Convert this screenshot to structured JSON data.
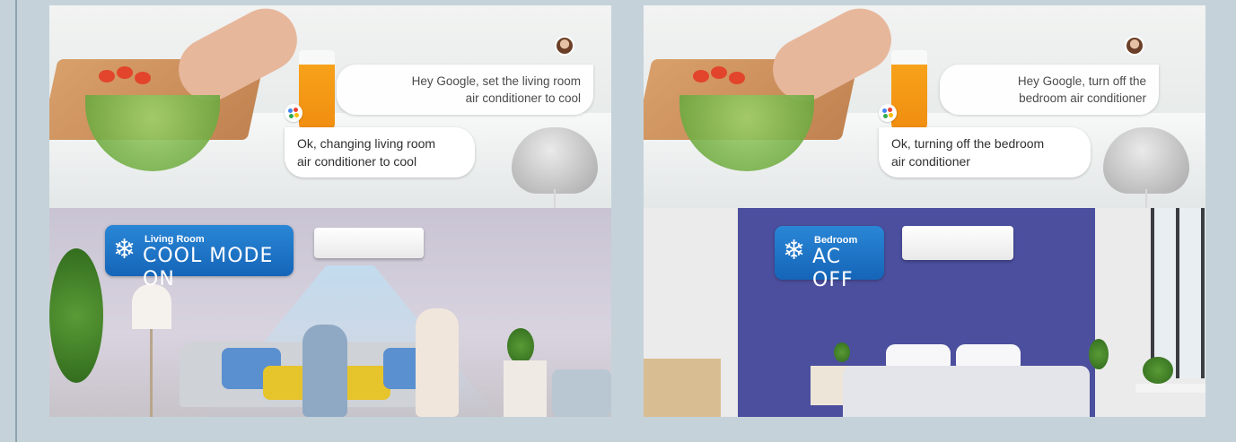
{
  "colors": {
    "page_background": "#c5d2da",
    "badge_blue": "#1e78c8",
    "bedroom_wall": "#4b4f9e"
  },
  "panels": [
    {
      "user_message": "Hey Google, set the living room air conditioner to cool",
      "user_line1": "Hey Google, set the living room",
      "user_line2": "air conditioner to cool",
      "assistant_line1": "Ok, changing living room",
      "assistant_line2": "air conditioner to cool",
      "status_room": "Living Room",
      "status_text": "COOL MODE ON",
      "status_icon": "snowflake-icon"
    },
    {
      "user_line1": "Hey Google, turn off the",
      "user_line2": "bedroom air conditioner",
      "assistant_line1": "Ok, turning off the bedroom",
      "assistant_line2": "air conditioner",
      "status_room": "Bedroom",
      "status_text": "AC OFF",
      "status_icon": "snowflake-icon"
    }
  ]
}
